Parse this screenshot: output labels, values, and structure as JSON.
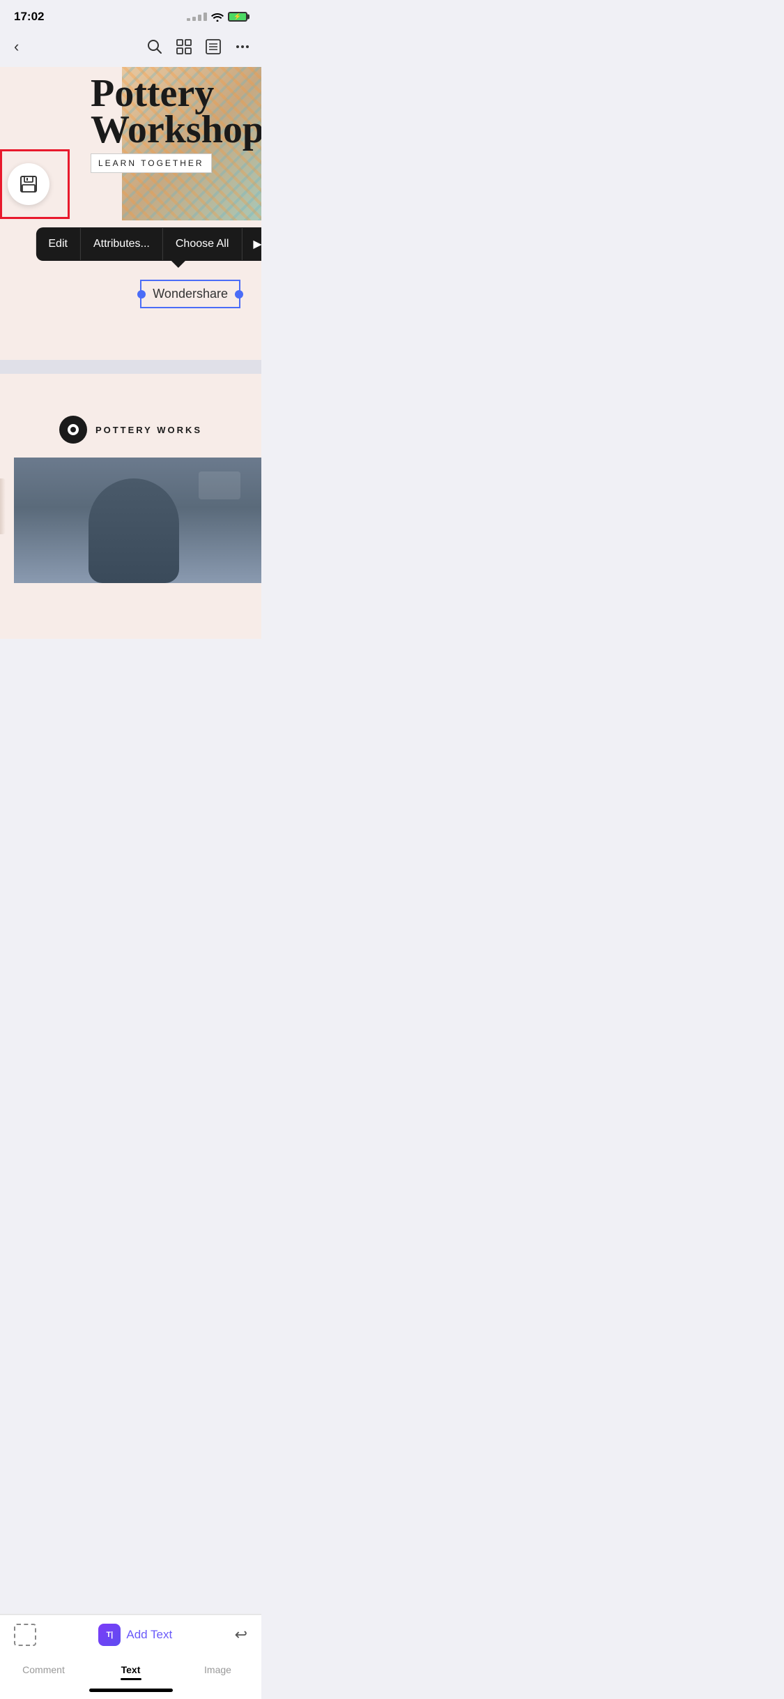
{
  "statusBar": {
    "time": "17:02"
  },
  "toolbar": {
    "backLabel": "‹",
    "searchIcon": "search",
    "gridIcon": "grid",
    "listIcon": "list",
    "moreIcon": "more"
  },
  "saveButton": {
    "label": "Save"
  },
  "canvas": {
    "title1": "Pottery",
    "title2": "Workshop",
    "subtitle": "LEARN TOGETHER"
  },
  "contextMenu": {
    "edit": "Edit",
    "attributes": "Attributes...",
    "chooseAll": "Choose All",
    "arrowLabel": "▶"
  },
  "wondershareElement": {
    "text": "Wondershare"
  },
  "secondPage": {
    "logoText": "POTTERY WORKS"
  },
  "addTextBar": {
    "label": "Add Text",
    "iconLabel": "T|"
  },
  "bottomTabs": {
    "comment": "Comment",
    "text": "Text",
    "image": "Image"
  }
}
